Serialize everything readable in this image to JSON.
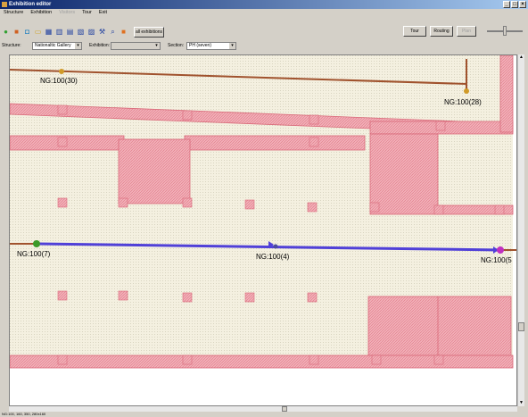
{
  "window": {
    "title": "Exhibition editor"
  },
  "menu": {
    "items": [
      "Structure",
      "Exhibition",
      "Visitors",
      "Tour",
      "Exit"
    ]
  },
  "toolbar": {
    "all_exhibitions": "all exhibitions"
  },
  "selectors": {
    "structure_label": "Structure:",
    "structure_value": "Nationaltic Gallery",
    "exhibition_label": "Exhibition:",
    "exhibition_value": "",
    "section_label": "Section:",
    "section_value": "PH (seven)"
  },
  "right_buttons": {
    "tour": "Tour",
    "routing": "Routing",
    "plan": "Plan"
  },
  "map": {
    "nodes": [
      {
        "id": "NG:100(30)",
        "color": "#d09a28"
      },
      {
        "id": "NG:100(28)",
        "color": "#d09a28"
      },
      {
        "id": "NG:100(7)",
        "color": "#3c9a28"
      },
      {
        "id": "NG:100(4)",
        "color": "#4a4aa0"
      },
      {
        "id": "NG:100(5",
        "color": "#c030c0"
      }
    ]
  },
  "colors": {
    "room_fill": "#f0a0ac",
    "room_edge": "#d86878",
    "path_brown": "#a0522d",
    "path_blue": "#5040d8"
  },
  "statusbar": {
    "text": "NG:100, 160, 350, 280x160"
  }
}
